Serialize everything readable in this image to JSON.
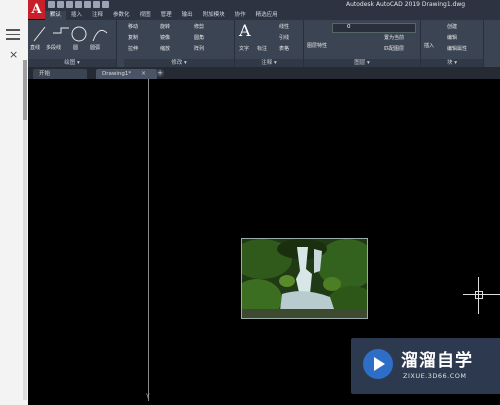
{
  "app": {
    "logo": "A",
    "title": "Autodesk AutoCAD 2019    Drawing1.dwg"
  },
  "ribbon_tabs": [
    {
      "label": "默认",
      "active": true
    },
    {
      "label": "插入",
      "active": false
    },
    {
      "label": "注释",
      "active": false
    },
    {
      "label": "参数化",
      "active": false
    },
    {
      "label": "视图",
      "active": false
    },
    {
      "label": "管理",
      "active": false
    },
    {
      "label": "输出",
      "active": false
    },
    {
      "label": "附加模块",
      "active": false
    },
    {
      "label": "协作",
      "active": false
    },
    {
      "label": "精选应用",
      "active": false
    }
  ],
  "panels": {
    "draw": {
      "label": "绘图 ▾",
      "tools": [
        "直线",
        "多段线",
        "圆",
        "圆弧"
      ]
    },
    "modify": {
      "label": "修改 ▾",
      "tools": [
        "移动",
        "旋转",
        "修剪",
        "复制",
        "镜像",
        "圆角",
        "拉伸",
        "缩放",
        "阵列"
      ]
    },
    "annotation": {
      "label": "注释 ▾",
      "tools": [
        "文字",
        "标注",
        "线性",
        "引线",
        "表格"
      ]
    },
    "layers": {
      "label": "图层 ▾",
      "tools": [
        "图层特性",
        "置为当前",
        "匹配图层"
      ],
      "current_layer": "0"
    },
    "block": {
      "label": "块 ▾",
      "tools": [
        "插入",
        "创建",
        "编辑",
        "编辑属性"
      ]
    }
  },
  "doc_tabs": {
    "start": "开始",
    "drawing": "Drawing1*",
    "close": "×",
    "add": "+"
  },
  "canvas": {
    "y_axis_label": "Y",
    "image_alt": "waterfall-photo"
  },
  "watermark": {
    "big": "溜溜自学",
    "small": "ZIXUE.3D66.COM"
  },
  "browser": {
    "close": "×"
  },
  "colors": {
    "ribbon": "#3b4453",
    "titlebar": "#2d3340",
    "logo": "#c8202a",
    "canvas": "#000000",
    "watermark_icon": "#2e6ec7"
  }
}
